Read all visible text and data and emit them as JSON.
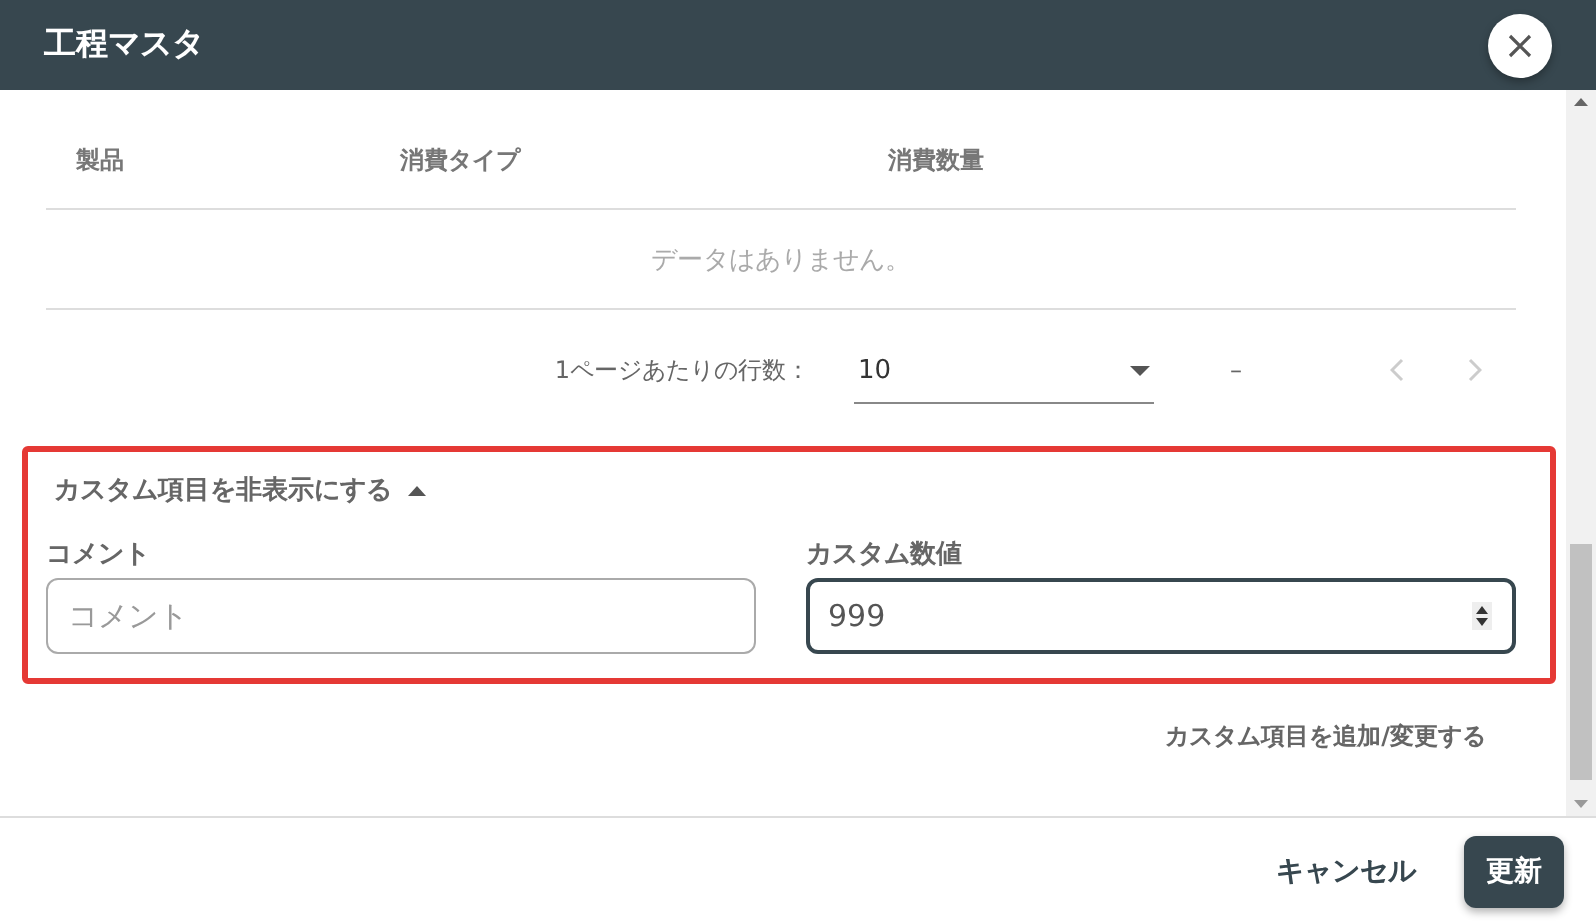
{
  "window": {
    "title": "工程マスタ"
  },
  "table": {
    "columns": [
      "製品",
      "消費タイプ",
      "消費数量"
    ],
    "empty_message": "データはありません。"
  },
  "pagination": {
    "rows_per_page_label": "1ページあたりの行数：",
    "rows_per_page": "10",
    "range": "–",
    "prev_disabled": true,
    "next_disabled": true
  },
  "custom_fields": {
    "toggle_label": "カスタム項目を非表示にする",
    "expanded": true,
    "highlighted": true,
    "fields": [
      {
        "label": "コメント",
        "placeholder": "コメント",
        "kind": "text",
        "focused": false
      },
      {
        "label": "カスタム数値",
        "value": "999",
        "kind": "number",
        "focused": true
      }
    ]
  },
  "add_custom_link": "カスタム項目を追加/変更する",
  "buttons": [
    {
      "label": "キャンセル",
      "kind": "text"
    },
    {
      "label": "更新",
      "kind": "primary"
    }
  ]
}
